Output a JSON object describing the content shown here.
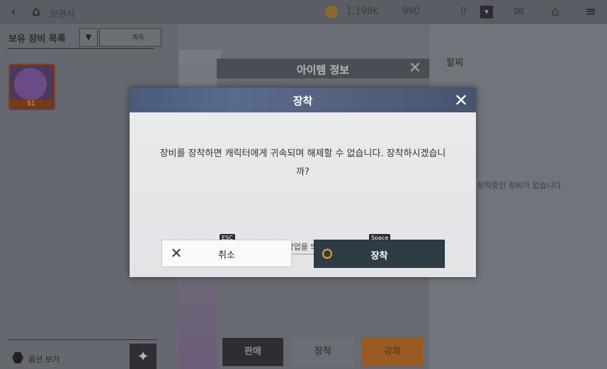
{
  "topbar": {
    "title": "보관사",
    "currency_gold": "1,198K",
    "currency_gem": "990",
    "currency_other": "0"
  },
  "inventory": {
    "header": "보유 장비 목록",
    "sort_label": "획득",
    "item_level": "S1",
    "option_label": "옵션 보기"
  },
  "item_info": {
    "title": "아이템 정보",
    "sell_label": "판매",
    "equip_label": "장착",
    "enhance_label": "강화"
  },
  "right_panel": {
    "slot_title": "팔찌",
    "empty_note": "재 장착중인 장비가 없습니다."
  },
  "modal": {
    "title": "장착",
    "message": "장비를 장착하면 캐릭터에게 귀속되며 해제할 수 없습니다. 장착하시겠습니까?",
    "dont_show_label": "앞으로 이 팝업을 띄우지 않습니다.",
    "cancel_key": "ESC",
    "cancel_label": "취소",
    "confirm_key": "Space",
    "confirm_label": "장착"
  },
  "colors": {
    "header_accent": "#4f5f80",
    "confirm_bg": "#2e3d45",
    "confirm_ring": "#f2a51e"
  }
}
